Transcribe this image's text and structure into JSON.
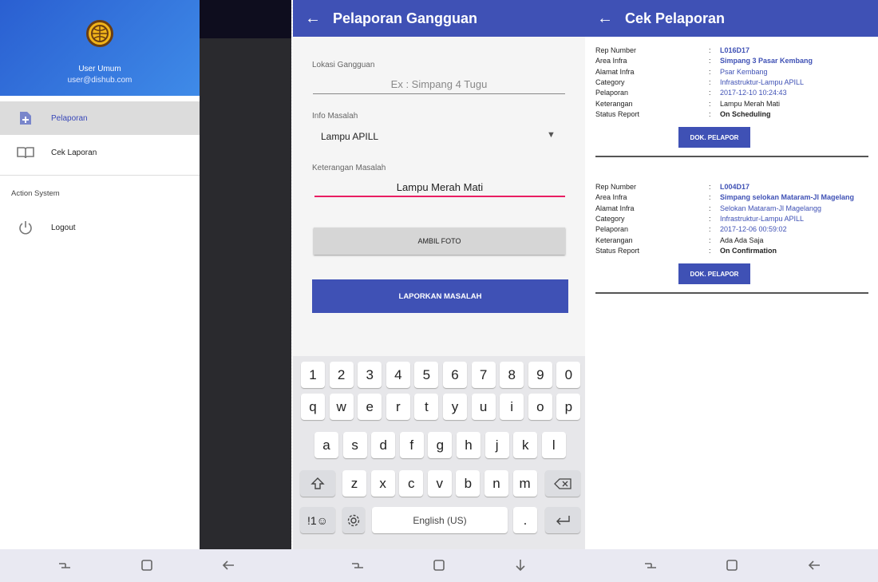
{
  "drawer": {
    "user_name": "User Umum",
    "user_email": "user@dishub.com",
    "items": [
      {
        "label": "Pelaporan",
        "icon": "add-document-icon"
      },
      {
        "label": "Cek Laporan",
        "icon": "book-icon"
      }
    ],
    "section_label": "Action System",
    "logout_label": "Logout",
    "logout_icon": "power-icon"
  },
  "form_screen": {
    "title": "Pelaporan Gangguan",
    "fields": {
      "lokasi_label": "Lokasi Gangguan",
      "lokasi_placeholder": "Ex : Simpang 4 Tugu",
      "info_label": "Info Masalah",
      "info_value": "Lampu APILL",
      "keterangan_label": "Keterangan Masalah",
      "keterangan_value": "Lampu Merah Mati"
    },
    "buttons": {
      "foto": "AMBIL FOTO",
      "lapor": "LAPORKAN MASALAH"
    },
    "keyboard": {
      "row_numbers": [
        "1",
        "2",
        "3",
        "4",
        "5",
        "6",
        "7",
        "8",
        "9",
        "0"
      ],
      "row_q": [
        "q",
        "w",
        "e",
        "r",
        "t",
        "y",
        "u",
        "i",
        "o",
        "p"
      ],
      "row_a": [
        "a",
        "s",
        "d",
        "f",
        "g",
        "h",
        "j",
        "k",
        "l"
      ],
      "row_z": [
        "z",
        "x",
        "c",
        "v",
        "b",
        "n",
        "m"
      ],
      "symbols_key": "!1☺",
      "space_label": "English (US)",
      "period_key": "."
    }
  },
  "report_screen": {
    "title": "Cek Pelaporan",
    "field_labels": [
      "Rep Number",
      "Area Infra",
      "Alamat Infra",
      "Category",
      "Pelaporan",
      "Keterangan",
      "Status Report"
    ],
    "separator": ":",
    "dok_button": "DOK. PELAPOR",
    "reports": [
      {
        "rep_number": "L016D17",
        "area_infra": "Simpang 3 Pasar Kembang",
        "alamat_infra": "Psar Kembang",
        "category": "Infrastruktur-Lampu APILL",
        "pelaporan": "2017-12-10 10:24:43",
        "keterangan": "Lampu Merah Mati",
        "status_report": "On Scheduling"
      },
      {
        "rep_number": "L004D17",
        "area_infra": "Simpang selokan Mataram-Jl Magelang",
        "alamat_infra": "Selokan Mataram-Jl Magelangg",
        "category": "Infrastruktur-Lampu APILL",
        "pelaporan": "2017-12-06 00:59:02",
        "keterangan": "Ada Ada Saja",
        "status_report": "On Confirmation"
      }
    ]
  },
  "colors": {
    "primary": "#3f51b5",
    "drawer_header": "#3a7be0",
    "accent": "#e91e63",
    "selected_item_bg": "#dcdcdc"
  }
}
